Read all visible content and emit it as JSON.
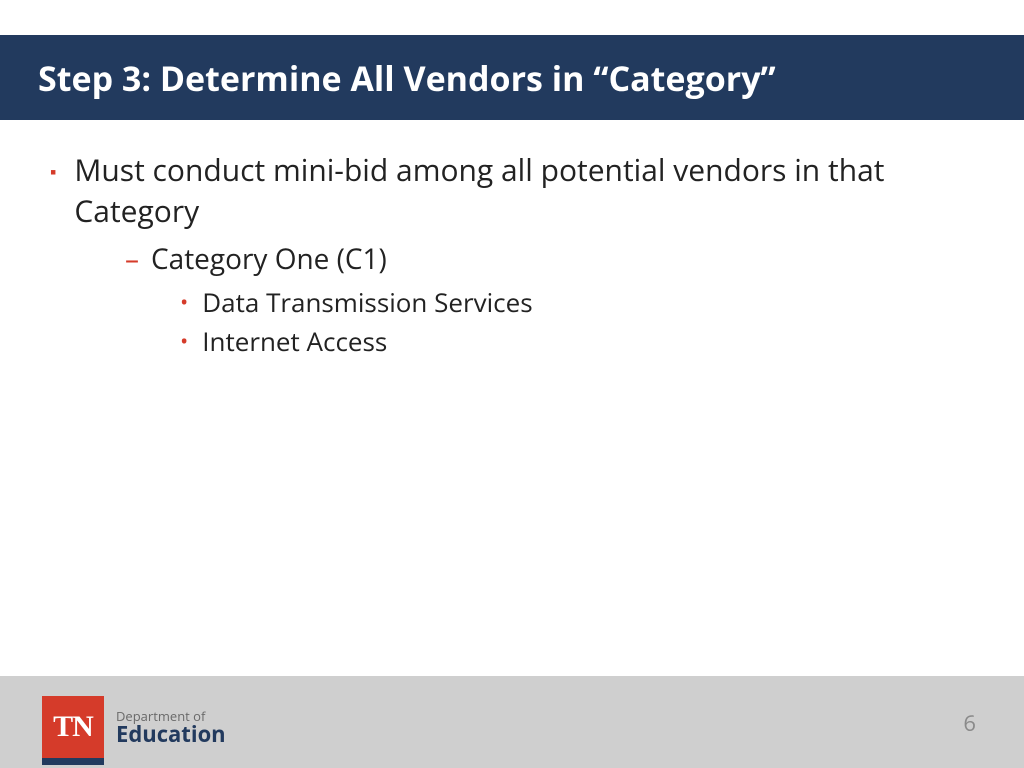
{
  "header": {
    "title": "Step 3: Determine All Vendors in “Category”"
  },
  "body": {
    "l1_item": "Must conduct mini-bid among all potential vendors in that Category",
    "l2_item": "Category One (C1)",
    "l3_items": [
      "Data Transmission Services",
      "Internet Access"
    ]
  },
  "footer": {
    "logo_text": "TN",
    "dept_line1": "Department of",
    "dept_line2": "Education",
    "page_number": "6"
  },
  "colors": {
    "header_bg": "#223a5e",
    "accent": "#d53b2a",
    "footer_bg": "#cfcfcf"
  }
}
